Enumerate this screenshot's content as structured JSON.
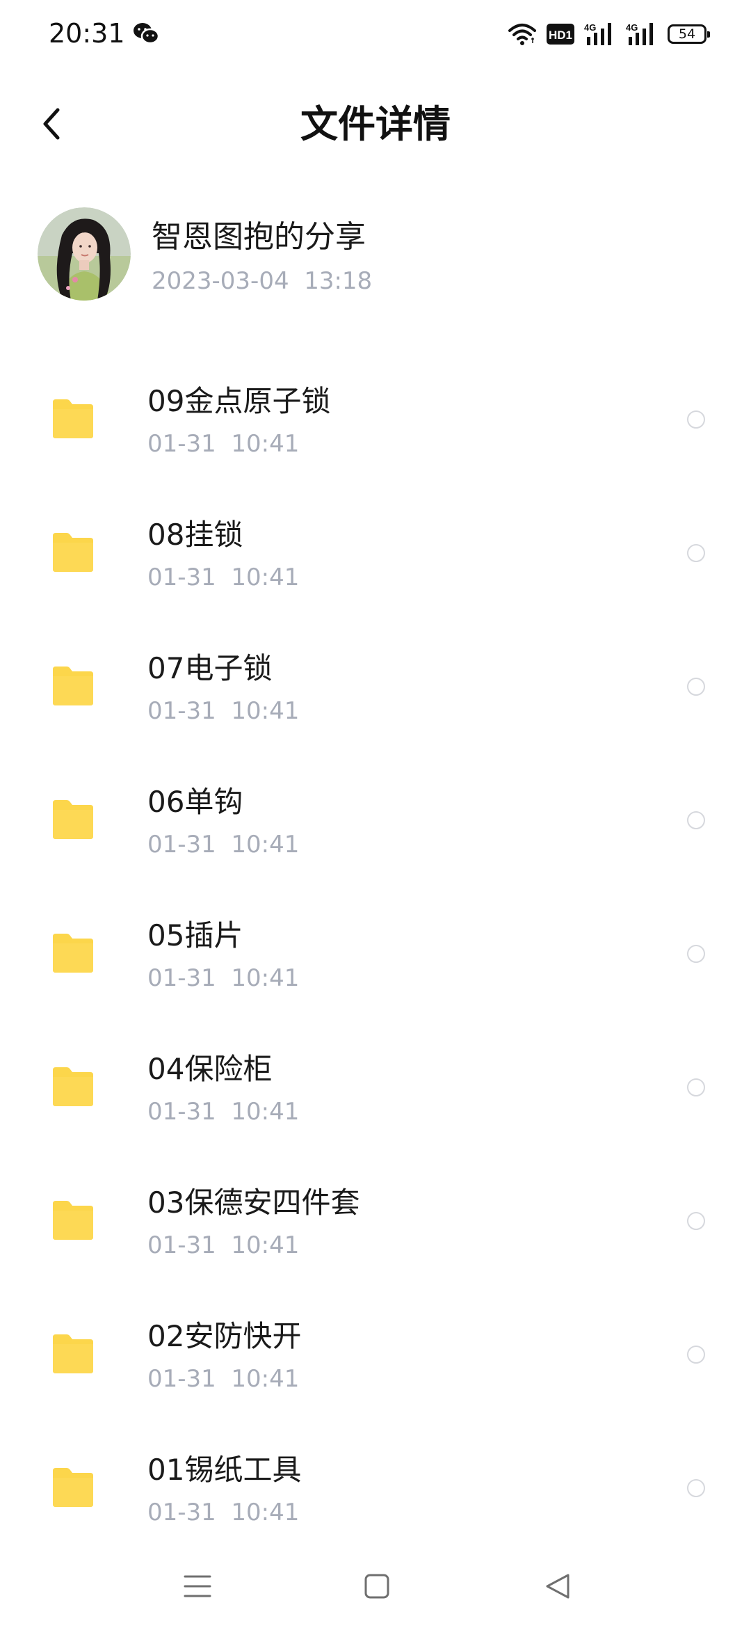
{
  "status_bar": {
    "time": "20:31",
    "network_badge": "HD1",
    "signal1_label": "4G",
    "signal2_label": "4G",
    "battery": "54"
  },
  "header": {
    "title": "文件详情"
  },
  "share": {
    "title": "智恩图抱的分享",
    "time": "2023-03-04  13:18"
  },
  "files": [
    {
      "name": "09金点原子锁",
      "time": "01-31  10:41"
    },
    {
      "name": "08挂锁",
      "time": "01-31  10:41"
    },
    {
      "name": "07电子锁",
      "time": "01-31  10:41"
    },
    {
      "name": "06单钩",
      "time": "01-31  10:41"
    },
    {
      "name": "05插片",
      "time": "01-31  10:41"
    },
    {
      "name": "04保险柜",
      "time": "01-31  10:41"
    },
    {
      "name": "03保德安四件套",
      "time": "01-31  10:41"
    },
    {
      "name": "02安防快开",
      "time": "01-31  10:41"
    },
    {
      "name": "01锡纸工具",
      "time": "01-31  10:41"
    }
  ],
  "colors": {
    "folder": "#fcd64b",
    "subtext": "#a7acb8",
    "radio_border": "#d6d8dd"
  },
  "icons": {
    "back": "chevron-left-icon",
    "folder": "folder-icon",
    "nav_menu": "menu-icon",
    "nav_home": "home-square-icon",
    "nav_back": "back-triangle-icon"
  }
}
